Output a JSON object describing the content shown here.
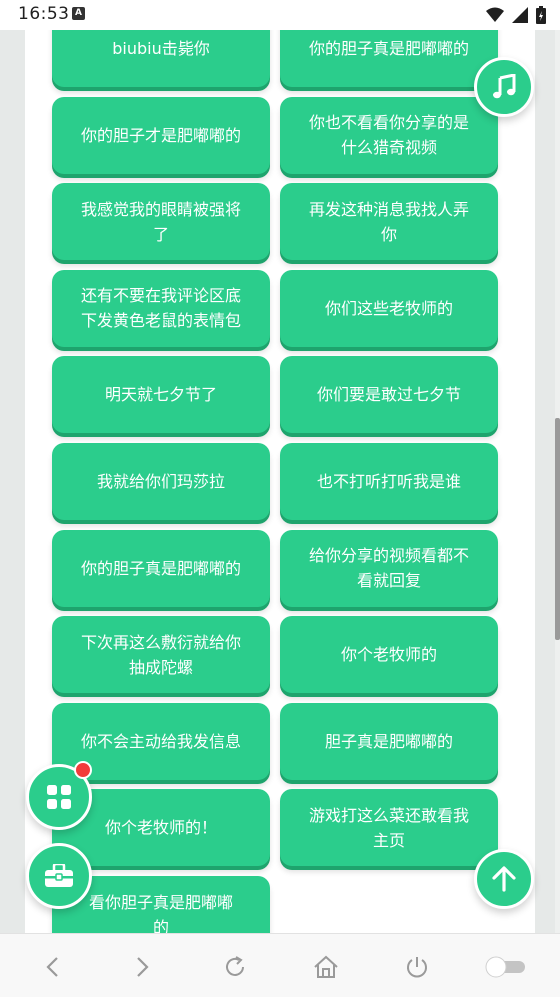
{
  "status_bar": {
    "time": "16:53",
    "notification_icon": "A",
    "icons": [
      "wifi-icon",
      "signal-icon",
      "battery-icon"
    ]
  },
  "phrases": [
    {
      "lines": [
        "biubiu击毙你"
      ]
    },
    {
      "lines": [
        "你的胆子真是肥嘟嘟的"
      ]
    },
    {
      "lines": [
        "你的胆子才是肥嘟嘟的"
      ]
    },
    {
      "lines": [
        "你也不看看你分享的是",
        "什么猎奇视频"
      ]
    },
    {
      "lines": [
        "我感觉我的眼睛被强将",
        "了"
      ]
    },
    {
      "lines": [
        "再发这种消息我找人弄",
        "你"
      ]
    },
    {
      "lines": [
        "还有不要在我评论区底",
        "下发黄色老鼠的表情包"
      ]
    },
    {
      "lines": [
        "你们这些老牧师的"
      ]
    },
    {
      "lines": [
        "明天就七夕节了"
      ]
    },
    {
      "lines": [
        "你们要是敢过七夕节"
      ]
    },
    {
      "lines": [
        "我就给你们玛莎拉"
      ]
    },
    {
      "lines": [
        "也不打听打听我是谁"
      ]
    },
    {
      "lines": [
        "你的胆子真是肥嘟嘟的"
      ]
    },
    {
      "lines": [
        "给你分享的视频看都不",
        "看就回复"
      ]
    },
    {
      "lines": [
        "下次再这么敷衍就给你",
        "抽成陀螺"
      ]
    },
    {
      "lines": [
        "你个老牧师的"
      ]
    },
    {
      "lines": [
        "你不会主动给我发信息"
      ]
    },
    {
      "lines": [
        "胆子真是肥嘟嘟的"
      ]
    },
    {
      "lines": [
        "你个老牧师的！"
      ]
    },
    {
      "lines": [
        "游戏打这么菜还敢看我",
        "主页"
      ]
    },
    {
      "lines": [
        "看你胆子真是肥嘟嘟",
        "的"
      ]
    }
  ],
  "fabs": {
    "music": "music-note-icon",
    "grid": "grid-icon",
    "toolbox": "toolbox-icon",
    "scroll_top": "arrow-up-icon"
  },
  "nav_bar": {
    "items": [
      "back-icon",
      "forward-icon",
      "refresh-icon",
      "home-icon",
      "power-icon",
      "toggle-switch"
    ]
  },
  "colors": {
    "accent": "#2bcd8c",
    "accent_dark": "#1ea46d",
    "badge": "#f23b3b"
  }
}
